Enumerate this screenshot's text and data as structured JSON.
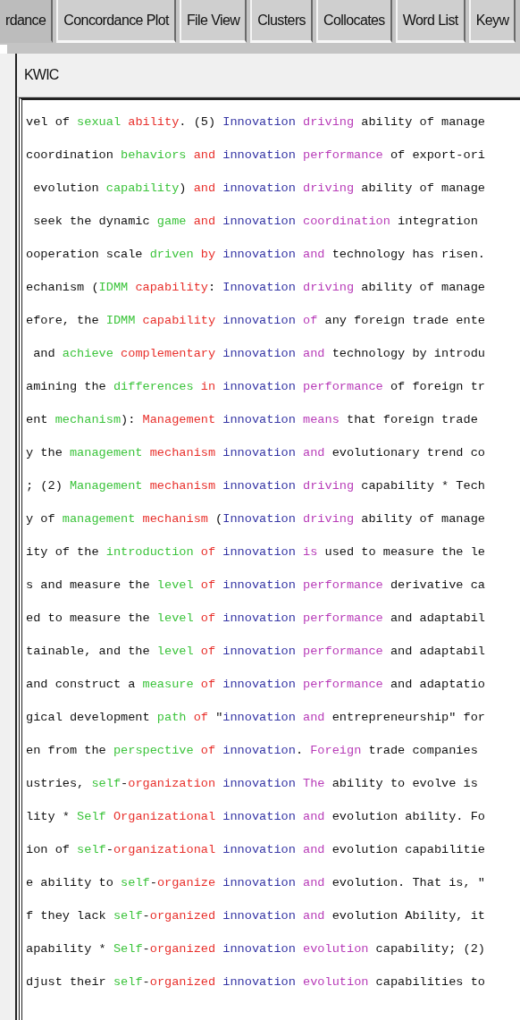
{
  "tabs": [
    {
      "label": "rdance",
      "selected": true
    },
    {
      "label": "Concordance Plot",
      "selected": false
    },
    {
      "label": "File View",
      "selected": false
    },
    {
      "label": "Clusters",
      "selected": false
    },
    {
      "label": "Collocates",
      "selected": false
    },
    {
      "label": "Word List",
      "selected": false
    },
    {
      "label": "Keyw",
      "selected": false
    }
  ],
  "panel": {
    "header": "KWIC"
  },
  "kwic_lines": [
    [
      {
        "kind": "plain",
        "text": "vel of "
      },
      {
        "kind": "l2",
        "text": "sexual "
      },
      {
        "kind": "l1",
        "text": "ability"
      },
      {
        "kind": "plain",
        "text": ". (5) "
      },
      {
        "kind": "node",
        "text": "Innovation "
      },
      {
        "kind": "r1",
        "text": "driving"
      },
      {
        "kind": "plain",
        "text": " ability of manage"
      }
    ],
    [
      {
        "kind": "plain",
        "text": "coordination "
      },
      {
        "kind": "l2",
        "text": "behaviors "
      },
      {
        "kind": "l1",
        "text": "and "
      },
      {
        "kind": "node",
        "text": "innovation "
      },
      {
        "kind": "r1",
        "text": "performance"
      },
      {
        "kind": "plain",
        "text": " of export-ori"
      }
    ],
    [
      {
        "kind": "plain",
        "text": " evolution "
      },
      {
        "kind": "l2",
        "text": "capability"
      },
      {
        "kind": "plain",
        "text": ") "
      },
      {
        "kind": "l1",
        "text": "and "
      },
      {
        "kind": "node",
        "text": "innovation "
      },
      {
        "kind": "r1",
        "text": "driving"
      },
      {
        "kind": "plain",
        "text": " ability of manage"
      }
    ],
    [
      {
        "kind": "plain",
        "text": " seek the dynamic "
      },
      {
        "kind": "l2",
        "text": "game "
      },
      {
        "kind": "l1",
        "text": "and "
      },
      {
        "kind": "node",
        "text": "innovation "
      },
      {
        "kind": "r1",
        "text": "coordination"
      },
      {
        "kind": "plain",
        "text": " integration"
      }
    ],
    [
      {
        "kind": "plain",
        "text": "ooperation scale "
      },
      {
        "kind": "l2",
        "text": "driven "
      },
      {
        "kind": "l1",
        "text": "by "
      },
      {
        "kind": "node",
        "text": "innovation "
      },
      {
        "kind": "r1",
        "text": "and"
      },
      {
        "kind": "plain",
        "text": " technology has risen."
      }
    ],
    [
      {
        "kind": "plain",
        "text": "echanism ("
      },
      {
        "kind": "l2",
        "text": "IDMM "
      },
      {
        "kind": "l1",
        "text": "capability"
      },
      {
        "kind": "plain",
        "text": ": "
      },
      {
        "kind": "node",
        "text": "Innovation "
      },
      {
        "kind": "r1",
        "text": "driving"
      },
      {
        "kind": "plain",
        "text": " ability of manage"
      }
    ],
    [
      {
        "kind": "plain",
        "text": "efore, the "
      },
      {
        "kind": "l2",
        "text": "IDMM "
      },
      {
        "kind": "l1",
        "text": "capability "
      },
      {
        "kind": "node",
        "text": "innovation "
      },
      {
        "kind": "r1",
        "text": "of"
      },
      {
        "kind": "plain",
        "text": " any foreign trade ente"
      }
    ],
    [
      {
        "kind": "plain",
        "text": " and "
      },
      {
        "kind": "l2",
        "text": "achieve "
      },
      {
        "kind": "l1",
        "text": "complementary "
      },
      {
        "kind": "node",
        "text": "innovation "
      },
      {
        "kind": "r1",
        "text": "and"
      },
      {
        "kind": "plain",
        "text": " technology by introdu"
      }
    ],
    [
      {
        "kind": "plain",
        "text": "amining the "
      },
      {
        "kind": "l2",
        "text": "differences "
      },
      {
        "kind": "l1",
        "text": "in "
      },
      {
        "kind": "node",
        "text": "innovation "
      },
      {
        "kind": "r1",
        "text": "performance"
      },
      {
        "kind": "plain",
        "text": " of foreign tr"
      }
    ],
    [
      {
        "kind": "plain",
        "text": "ent "
      },
      {
        "kind": "l2",
        "text": "mechanism"
      },
      {
        "kind": "plain",
        "text": "): "
      },
      {
        "kind": "l1",
        "text": "Management "
      },
      {
        "kind": "node",
        "text": "innovation "
      },
      {
        "kind": "r1",
        "text": "means"
      },
      {
        "kind": "plain",
        "text": " that foreign trade"
      }
    ],
    [
      {
        "kind": "plain",
        "text": "y the "
      },
      {
        "kind": "l2",
        "text": "management "
      },
      {
        "kind": "l1",
        "text": "mechanism "
      },
      {
        "kind": "node",
        "text": "innovation "
      },
      {
        "kind": "r1",
        "text": "and"
      },
      {
        "kind": "plain",
        "text": " evolutionary trend co"
      }
    ],
    [
      {
        "kind": "plain",
        "text": "; (2) "
      },
      {
        "kind": "l2",
        "text": "Management "
      },
      {
        "kind": "l1",
        "text": "mechanism "
      },
      {
        "kind": "node",
        "text": "innovation "
      },
      {
        "kind": "r1",
        "text": "driving"
      },
      {
        "kind": "plain",
        "text": " capability * Tech"
      }
    ],
    [
      {
        "kind": "plain",
        "text": "y of "
      },
      {
        "kind": "l2",
        "text": "management "
      },
      {
        "kind": "l1",
        "text": "mechanism"
      },
      {
        "kind": "plain",
        "text": " ("
      },
      {
        "kind": "node",
        "text": "Innovation "
      },
      {
        "kind": "r1",
        "text": "driving"
      },
      {
        "kind": "plain",
        "text": " ability of manage"
      }
    ],
    [
      {
        "kind": "plain",
        "text": "ity of the "
      },
      {
        "kind": "l2",
        "text": "introduction "
      },
      {
        "kind": "l1",
        "text": "of "
      },
      {
        "kind": "node",
        "text": "innovation "
      },
      {
        "kind": "r1",
        "text": "is"
      },
      {
        "kind": "plain",
        "text": " used to measure the le"
      }
    ],
    [
      {
        "kind": "plain",
        "text": "s and measure the "
      },
      {
        "kind": "l2",
        "text": "level "
      },
      {
        "kind": "l1",
        "text": "of "
      },
      {
        "kind": "node",
        "text": "innovation "
      },
      {
        "kind": "r1",
        "text": "performance"
      },
      {
        "kind": "plain",
        "text": " derivative ca"
      }
    ],
    [
      {
        "kind": "plain",
        "text": "ed to measure the "
      },
      {
        "kind": "l2",
        "text": "level "
      },
      {
        "kind": "l1",
        "text": "of "
      },
      {
        "kind": "node",
        "text": "innovation "
      },
      {
        "kind": "r1",
        "text": "performance"
      },
      {
        "kind": "plain",
        "text": " and adaptabil"
      }
    ],
    [
      {
        "kind": "plain",
        "text": "tainable, and the "
      },
      {
        "kind": "l2",
        "text": "level "
      },
      {
        "kind": "l1",
        "text": "of "
      },
      {
        "kind": "node",
        "text": "innovation "
      },
      {
        "kind": "r1",
        "text": "performance"
      },
      {
        "kind": "plain",
        "text": " and adaptabil"
      }
    ],
    [
      {
        "kind": "plain",
        "text": "and construct a "
      },
      {
        "kind": "l2",
        "text": "measure "
      },
      {
        "kind": "l1",
        "text": "of "
      },
      {
        "kind": "node",
        "text": "innovation "
      },
      {
        "kind": "r1",
        "text": "performance"
      },
      {
        "kind": "plain",
        "text": " and adaptatio"
      }
    ],
    [
      {
        "kind": "plain",
        "text": "gical development "
      },
      {
        "kind": "l2",
        "text": "path "
      },
      {
        "kind": "l1",
        "text": "of"
      },
      {
        "kind": "plain",
        "text": " \""
      },
      {
        "kind": "node",
        "text": "innovation "
      },
      {
        "kind": "r1",
        "text": "and"
      },
      {
        "kind": "plain",
        "text": " entrepreneurship\" for"
      }
    ],
    [
      {
        "kind": "plain",
        "text": "en from the "
      },
      {
        "kind": "l2",
        "text": "perspective "
      },
      {
        "kind": "l1",
        "text": "of "
      },
      {
        "kind": "node",
        "text": "innovation"
      },
      {
        "kind": "plain",
        "text": ". "
      },
      {
        "kind": "r1",
        "text": "Foreign"
      },
      {
        "kind": "plain",
        "text": " trade companies"
      }
    ],
    [
      {
        "kind": "plain",
        "text": "ustries, "
      },
      {
        "kind": "l2",
        "text": "self"
      },
      {
        "kind": "plain",
        "text": "-"
      },
      {
        "kind": "l1",
        "text": "organization "
      },
      {
        "kind": "node",
        "text": "innovation "
      },
      {
        "kind": "r1",
        "text": "The"
      },
      {
        "kind": "plain",
        "text": " ability to evolve is"
      }
    ],
    [
      {
        "kind": "plain",
        "text": "lity * "
      },
      {
        "kind": "l2",
        "text": "Self "
      },
      {
        "kind": "l1",
        "text": "Organizational "
      },
      {
        "kind": "node",
        "text": "innovation "
      },
      {
        "kind": "r1",
        "text": "and"
      },
      {
        "kind": "plain",
        "text": " evolution ability. Fo"
      }
    ],
    [
      {
        "kind": "plain",
        "text": "ion of "
      },
      {
        "kind": "l2",
        "text": "self"
      },
      {
        "kind": "plain",
        "text": "-"
      },
      {
        "kind": "l1",
        "text": "organizational "
      },
      {
        "kind": "node",
        "text": "innovation "
      },
      {
        "kind": "r1",
        "text": "and"
      },
      {
        "kind": "plain",
        "text": " evolution capabilitie"
      }
    ],
    [
      {
        "kind": "plain",
        "text": "e ability to "
      },
      {
        "kind": "l2",
        "text": "self"
      },
      {
        "kind": "plain",
        "text": "-"
      },
      {
        "kind": "l1",
        "text": "organize "
      },
      {
        "kind": "node",
        "text": "innovation "
      },
      {
        "kind": "r1",
        "text": "and"
      },
      {
        "kind": "plain",
        "text": " evolution. That is, \""
      }
    ],
    [
      {
        "kind": "plain",
        "text": "f they lack "
      },
      {
        "kind": "l2",
        "text": "self"
      },
      {
        "kind": "plain",
        "text": "-"
      },
      {
        "kind": "l1",
        "text": "organized "
      },
      {
        "kind": "node",
        "text": "innovation "
      },
      {
        "kind": "r1",
        "text": "and"
      },
      {
        "kind": "plain",
        "text": " evolution Ability, it"
      }
    ],
    [
      {
        "kind": "plain",
        "text": "apability * "
      },
      {
        "kind": "l2",
        "text": "Self"
      },
      {
        "kind": "plain",
        "text": "-"
      },
      {
        "kind": "l1",
        "text": "organized "
      },
      {
        "kind": "node",
        "text": "innovation "
      },
      {
        "kind": "r1",
        "text": "evolution"
      },
      {
        "kind": "plain",
        "text": " capability; (2)"
      }
    ],
    [
      {
        "kind": "plain",
        "text": "djust their "
      },
      {
        "kind": "l2",
        "text": "self"
      },
      {
        "kind": "plain",
        "text": "-"
      },
      {
        "kind": "l1",
        "text": "organized "
      },
      {
        "kind": "node",
        "text": "innovation "
      },
      {
        "kind": "r1",
        "text": "evolution"
      },
      {
        "kind": "plain",
        "text": " capabilities to"
      }
    ]
  ]
}
